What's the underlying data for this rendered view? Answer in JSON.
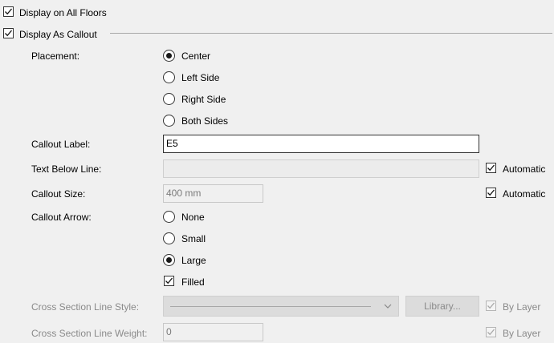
{
  "display_all_floors": {
    "label": "Display on All Floors",
    "checked": true
  },
  "display_as_callout": {
    "label": "Display As Callout",
    "checked": true
  },
  "placement": {
    "label": "Placement:",
    "options": [
      "Center",
      "Left Side",
      "Right Side",
      "Both Sides"
    ],
    "selected": "Center"
  },
  "callout_label": {
    "label": "Callout Label:",
    "value": "E5"
  },
  "text_below_line": {
    "label": "Text Below Line:",
    "value": "",
    "automatic_label": "Automatic",
    "automatic": true
  },
  "callout_size": {
    "label": "Callout Size:",
    "value": "400 mm",
    "automatic_label": "Automatic",
    "automatic": true
  },
  "callout_arrow": {
    "label": "Callout Arrow:",
    "options": [
      "None",
      "Small",
      "Large"
    ],
    "selected": "Large",
    "filled_label": "Filled",
    "filled": true
  },
  "cross_section_line_style": {
    "label": "Cross Section Line Style:",
    "library_label": "Library...",
    "by_layer_label": "By Layer",
    "by_layer": true
  },
  "cross_section_line_weight": {
    "label": "Cross Section Line Weight:",
    "value": "0",
    "by_layer_label": "By Layer",
    "by_layer": true
  }
}
